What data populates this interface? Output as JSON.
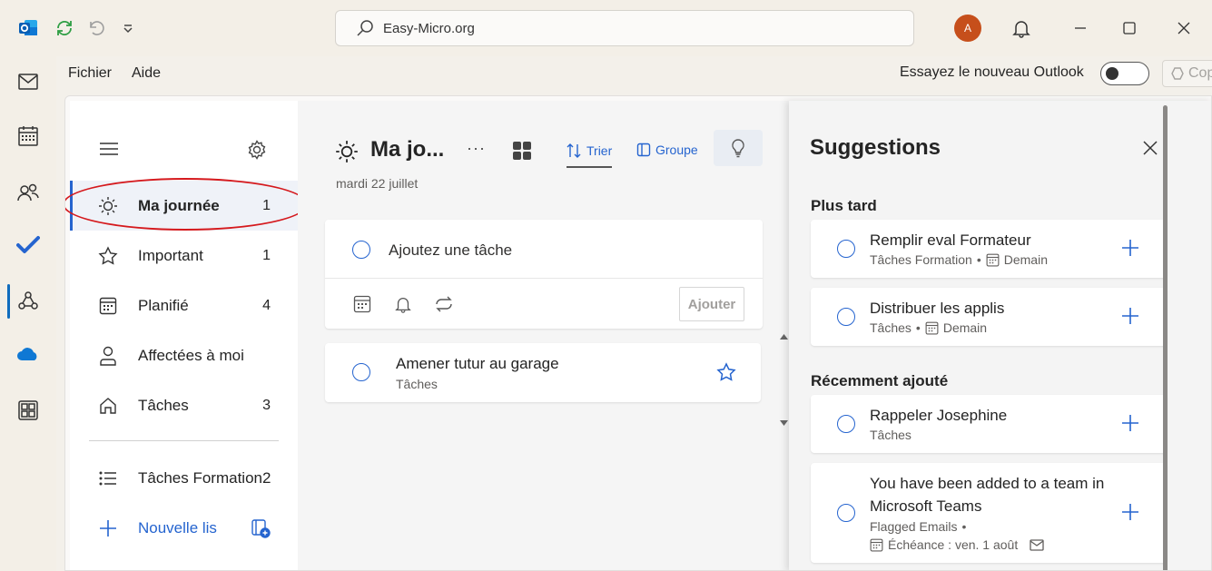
{
  "window": {
    "search_text": "Easy-Micro.org",
    "avatar_initial": "A"
  },
  "menu": {
    "fichier": "Fichier",
    "aide": "Aide",
    "try_new_outlook": "Essayez le nouveau Outlook",
    "copilot": "Copilot"
  },
  "sidebar": {
    "items": [
      {
        "label": "Ma journée",
        "count": "1",
        "icon": "sun-icon"
      },
      {
        "label": "Important",
        "count": "1",
        "icon": "star-icon"
      },
      {
        "label": "Planifié",
        "count": "4",
        "icon": "calendar-icon"
      },
      {
        "label": "Affectées à moi",
        "count": "",
        "icon": "person-icon"
      },
      {
        "label": "Tâches",
        "count": "3",
        "icon": "home-icon"
      }
    ],
    "lists": [
      {
        "label": "Tâches Formation2",
        "icon": "list-icon"
      }
    ],
    "new_list": "Nouvelle lis"
  },
  "main": {
    "title": "Ma jo...",
    "date": "mardi 22 juillet",
    "more": "···",
    "sort": "Trier",
    "group": "Groupe",
    "add_task_placeholder": "Ajoutez une tâche",
    "add_button": "Ajouter",
    "tasks": [
      {
        "title": "Amener tutur au garage",
        "list": "Tâches"
      }
    ]
  },
  "suggestions": {
    "title": "Suggestions",
    "later_title": "Plus tard",
    "recent_title": "Récemment ajouté",
    "later": [
      {
        "title": "Remplir eval Formateur",
        "list": "Tâches Formation",
        "bullet": "•",
        "due": "Demain"
      },
      {
        "title": "Distribuer les applis",
        "list": "Tâches",
        "bullet": "•",
        "due": "Demain"
      }
    ],
    "recent": [
      {
        "title": "Rappeler Josephine",
        "list": "Tâches"
      },
      {
        "title_line1": "You have been added to a team in",
        "title_line2": "Microsoft Teams",
        "list": "Flagged Emails",
        "bullet": "•",
        "due": "Échéance : ven. 1 août"
      }
    ]
  },
  "colors": {
    "accent": "#2564cf",
    "outlook_blue": "#0f6cbd",
    "avatar": "#c64f1b",
    "highlight": "#d5191d"
  }
}
